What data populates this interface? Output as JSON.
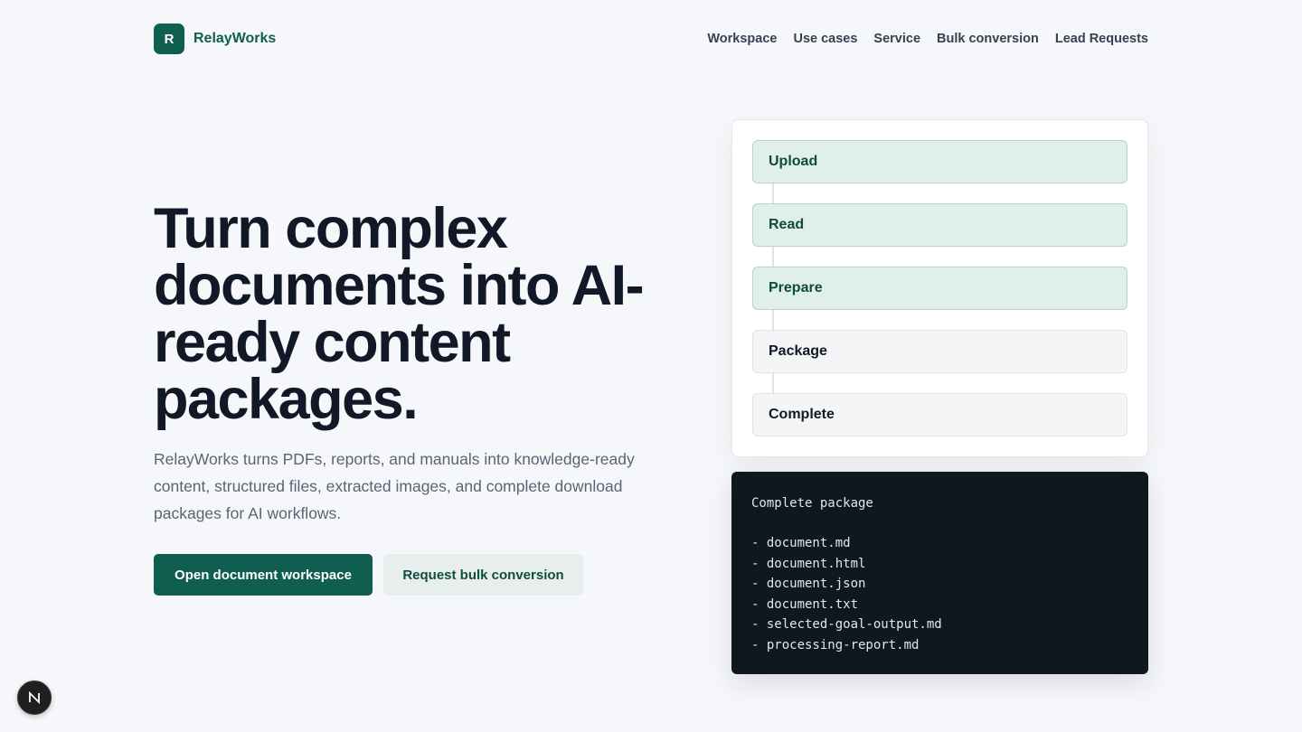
{
  "brand": {
    "mark": "R",
    "name": "RelayWorks"
  },
  "nav": {
    "items": [
      {
        "label": "Workspace"
      },
      {
        "label": "Use cases"
      },
      {
        "label": "Service"
      },
      {
        "label": "Bulk conversion"
      },
      {
        "label": "Lead Requests"
      }
    ]
  },
  "hero": {
    "title": "Turn complex documents into AI-ready content packages.",
    "description": "RelayWorks turns PDFs, reports, and manuals into knowledge-ready content, structured files, extracted images, and complete download packages for AI workflows.",
    "primary_cta": "Open document workspace",
    "secondary_cta": "Request bulk conversion"
  },
  "steps": [
    {
      "label": "Upload",
      "status": "done"
    },
    {
      "label": "Read",
      "status": "done"
    },
    {
      "label": "Prepare",
      "status": "done"
    },
    {
      "label": "Package",
      "status": "pending"
    },
    {
      "label": "Complete",
      "status": "pending"
    }
  ],
  "package": {
    "title": "Complete package",
    "files": [
      "- document.md",
      "- document.html",
      "- document.json",
      "- document.txt",
      "- selected-goal-output.md",
      "- processing-report.md"
    ]
  },
  "colors": {
    "brand": "#0f5e4f",
    "step_done_bg": "#e0efea",
    "terminal_bg": "#0f171f"
  },
  "icons": {
    "floating_badge": "next-n-icon"
  }
}
